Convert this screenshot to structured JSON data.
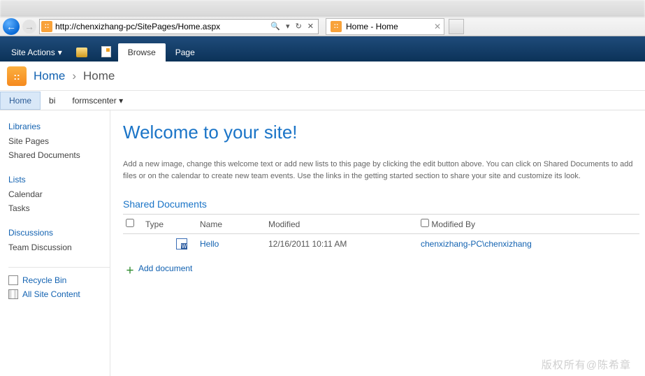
{
  "browser": {
    "url": "http://chenxizhang-pc/SitePages/Home.aspx",
    "tab_title": "Home - Home",
    "search_icon": "🔍"
  },
  "ribbon": {
    "site_actions": "Site Actions",
    "tabs": {
      "browse": "Browse",
      "page": "Page"
    }
  },
  "breadcrumb": {
    "site": "Home",
    "page": "Home"
  },
  "topnav": {
    "home": "Home",
    "bi": "bi",
    "formscenter": "formscenter"
  },
  "leftnav": {
    "libraries": "Libraries",
    "site_pages": "Site Pages",
    "shared_documents": "Shared Documents",
    "lists": "Lists",
    "calendar": "Calendar",
    "tasks": "Tasks",
    "discussions": "Discussions",
    "team_discussion": "Team Discussion",
    "recycle_bin": "Recycle Bin",
    "all_site_content": "All Site Content"
  },
  "content": {
    "welcome_title": "Welcome to your site!",
    "intro": "Add a new image, change this welcome text or add new lists to this page by clicking the edit button above. You can click on Shared Documents to add files or on the calendar to create new team events. Use the links in the getting started section to share your site and customize its look.",
    "shared_docs_heading": "Shared Documents",
    "columns": {
      "type": "Type",
      "name": "Name",
      "modified": "Modified",
      "modified_by": "Modified By"
    },
    "rows": [
      {
        "name": "Hello",
        "modified": "12/16/2011 10:11 AM",
        "modified_by": "chenxizhang-PC\\chenxizhang"
      }
    ],
    "add_document": "Add document"
  },
  "footer": "版权所有@陈希章"
}
